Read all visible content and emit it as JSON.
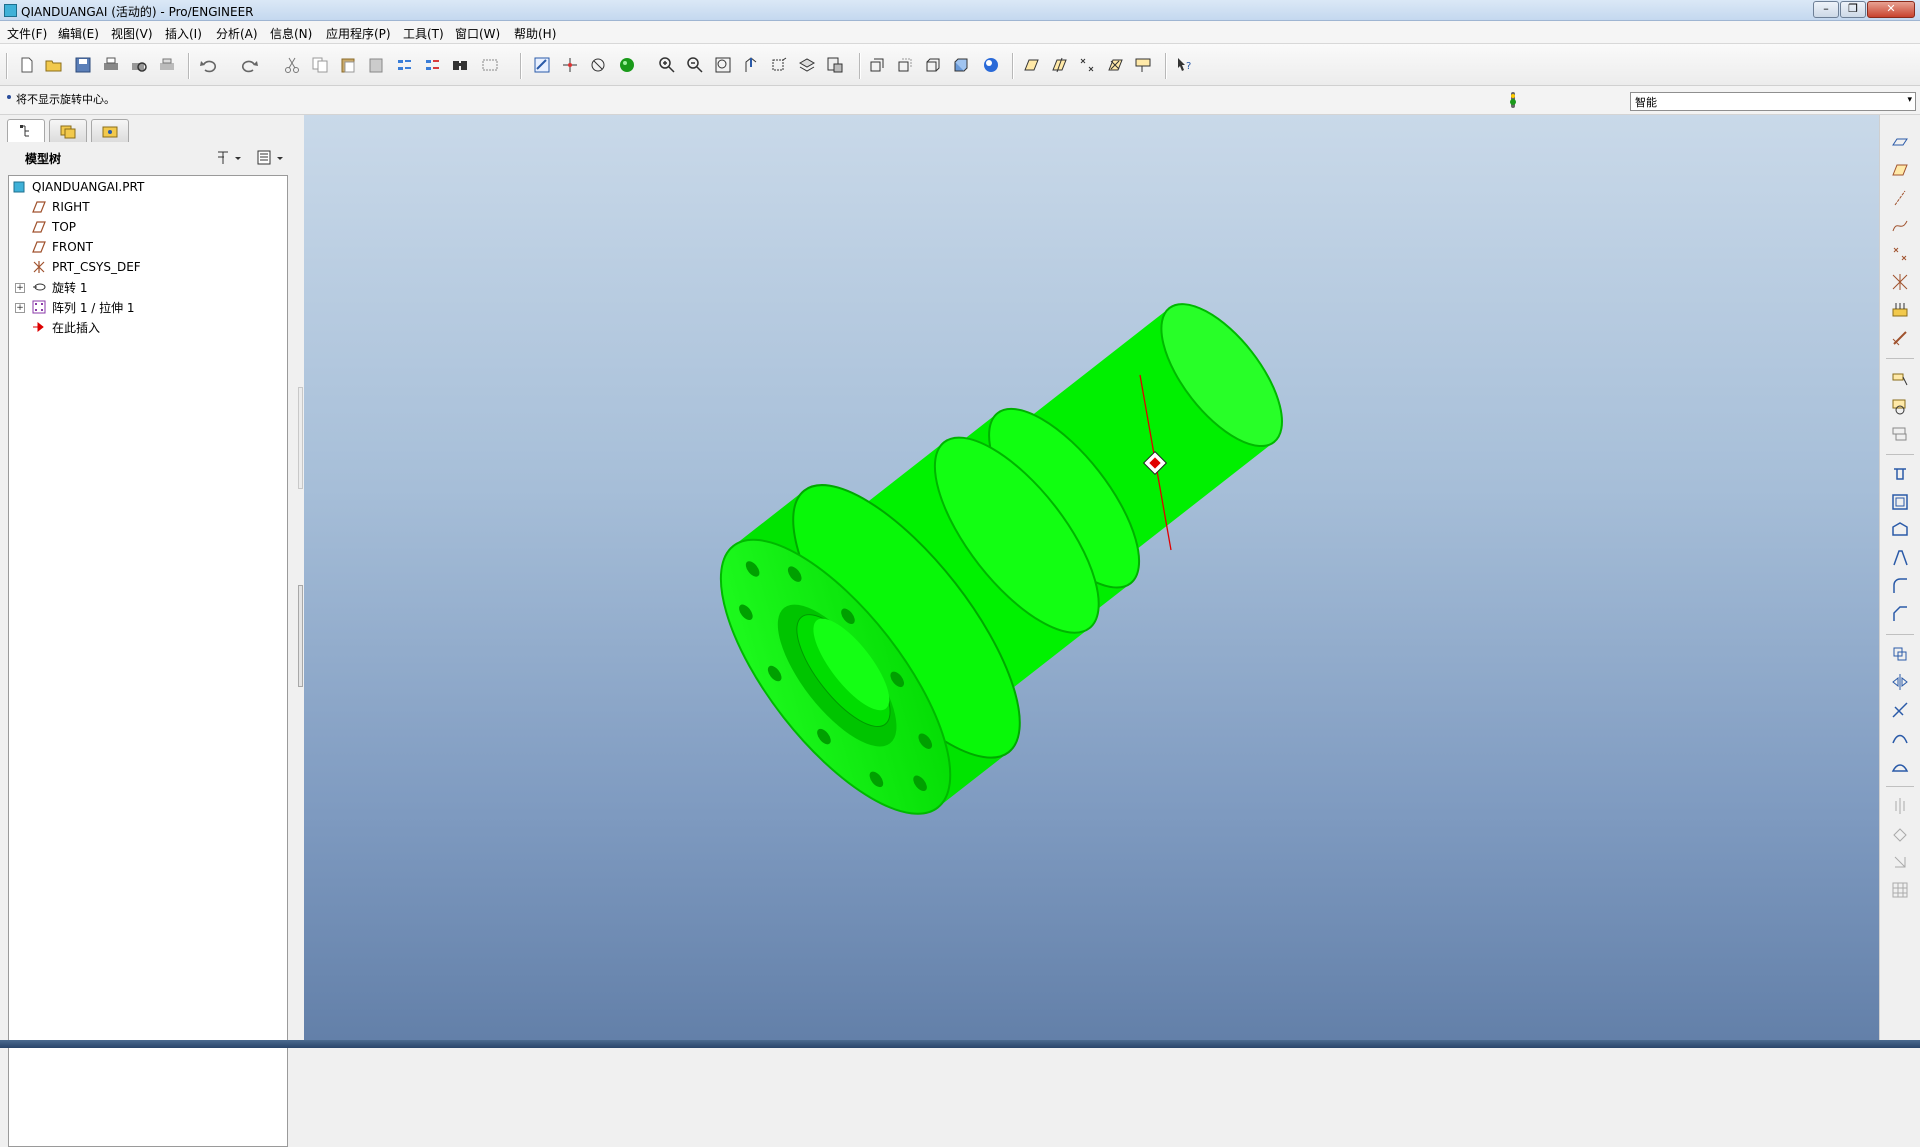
{
  "window": {
    "title": "QIANDUANGAI (活动的) - Pro/ENGINEER",
    "minimize_label": "–",
    "maximize_label": "❐",
    "close_label": "✕"
  },
  "menu": {
    "items": [
      {
        "label": "文件(F)"
      },
      {
        "label": "编辑(E)"
      },
      {
        "label": "视图(V)"
      },
      {
        "label": "插入(I)"
      },
      {
        "label": "分析(A)"
      },
      {
        "label": "信息(N)"
      },
      {
        "label": "应用程序(P)"
      },
      {
        "label": "工具(T)"
      },
      {
        "label": "窗口(W)"
      },
      {
        "label": "帮助(H)"
      }
    ]
  },
  "message": {
    "text": "将不显示旋转中心。"
  },
  "filter": {
    "value": "智能"
  },
  "model_tree": {
    "title": "模型树",
    "items": [
      {
        "label": "QIANDUANGAI.PRT",
        "icon": "part-icon"
      },
      {
        "label": "RIGHT",
        "icon": "datum-plane-icon"
      },
      {
        "label": "TOP",
        "icon": "datum-plane-icon"
      },
      {
        "label": "FRONT",
        "icon": "datum-plane-icon"
      },
      {
        "label": "PRT_CSYS_DEF",
        "icon": "csys-icon"
      },
      {
        "label": "旋转 1",
        "icon": "revolve-icon"
      },
      {
        "label": "阵列 1 / 拉伸 1",
        "icon": "pattern-icon"
      },
      {
        "label": "在此插入",
        "icon": "insert-here-icon"
      }
    ]
  },
  "colors": {
    "model_green": "#00ff00",
    "model_dark": "#00b800",
    "viewport_top": "#c9d9e9",
    "viewport_bottom": "#627fa8",
    "axis_red": "#e00000"
  }
}
